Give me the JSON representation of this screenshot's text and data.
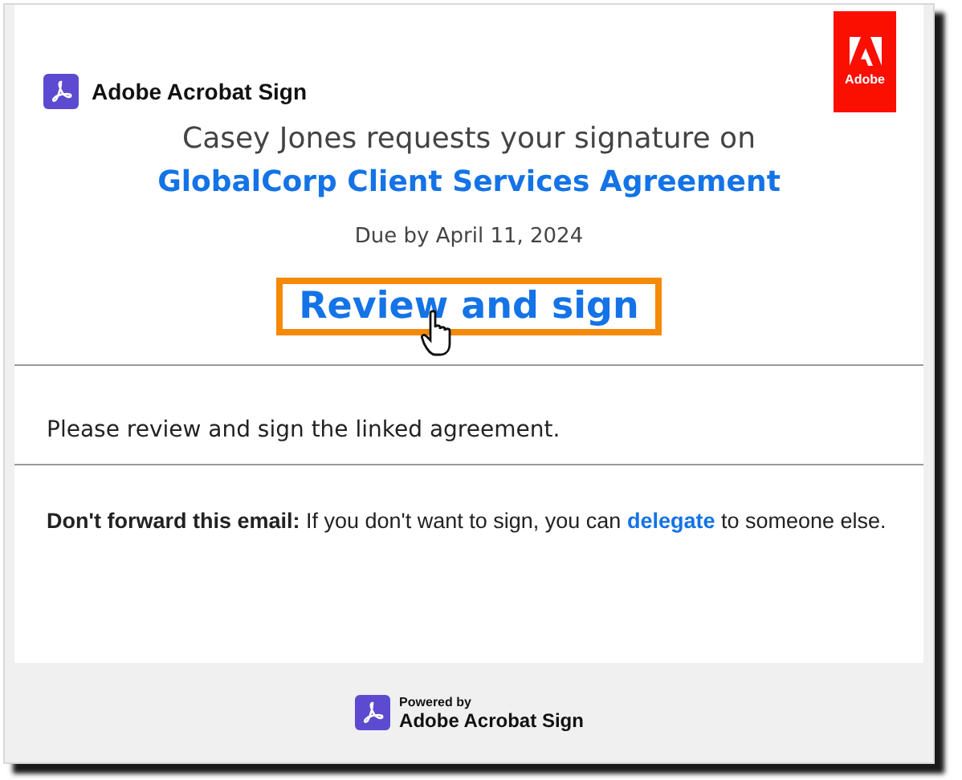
{
  "header": {
    "brand": "Adobe Acrobat Sign",
    "badge": "Adobe"
  },
  "request": {
    "line": "Casey Jones requests your signature on",
    "agreement": "GlobalCorp Client Services Agreement",
    "due": "Due by April 11, 2024"
  },
  "action": {
    "label": "Review and sign",
    "highlighted": true
  },
  "message": "Please review and sign the linked agreement.",
  "notice": {
    "lead": "**Don't forward this email:** If you don't want to sign, you can",
    "link": "delegate",
    "tail": "to someone else."
  },
  "footer": {
    "powered": "Powered by",
    "brand": "Adobe Acrobat Sign"
  }
}
